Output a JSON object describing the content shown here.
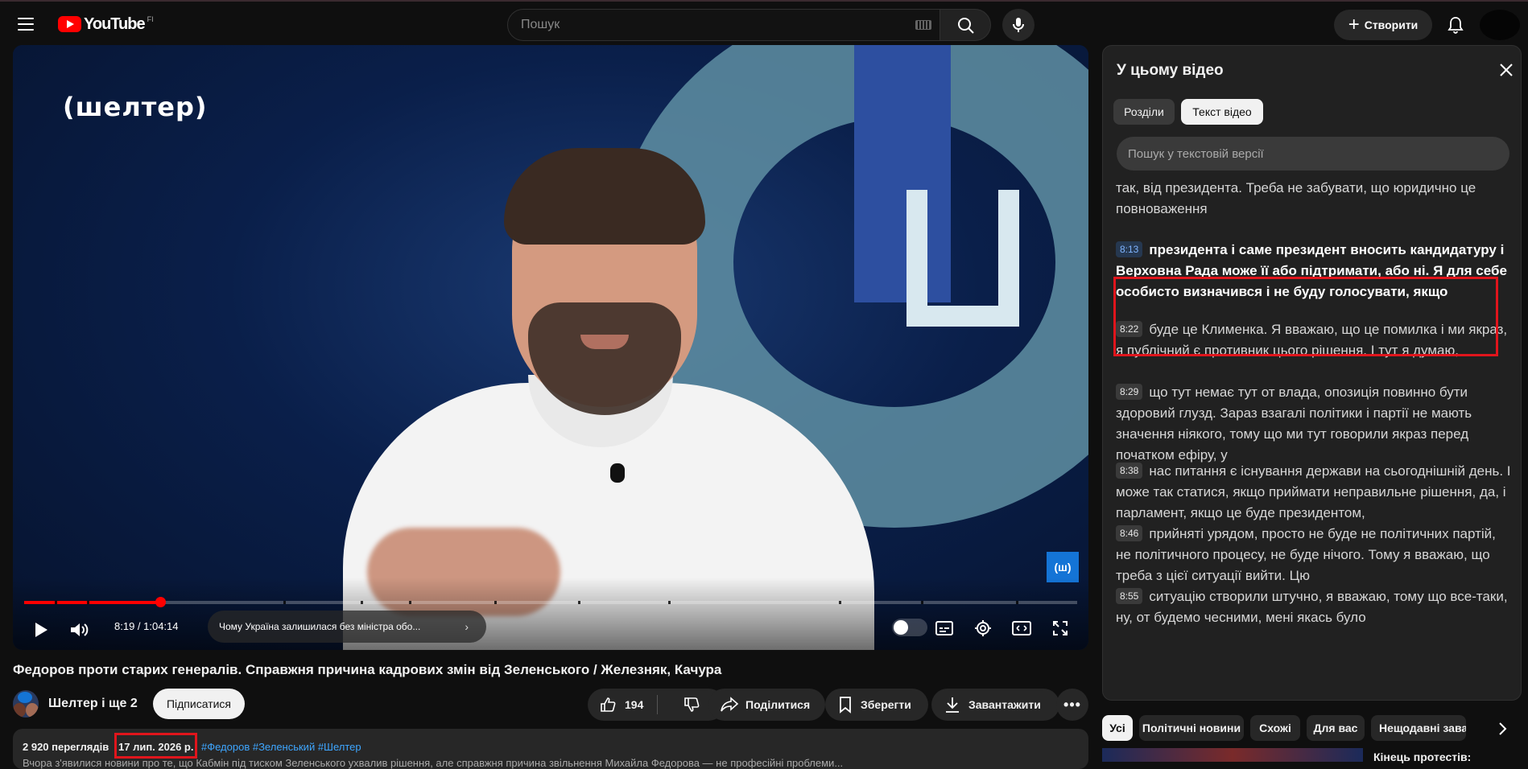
{
  "header": {
    "logo_text": "YouTube",
    "region": "FI",
    "search_placeholder": "Пошук",
    "create_label": "Створити"
  },
  "player": {
    "brand_overlay": "(шелтер)",
    "corner_badge": "(ш)",
    "time": "8:19 / 1:04:14",
    "chapter_title": "Чому Україна залишилася без міністра обо...",
    "progress_fraction": 0.129
  },
  "video": {
    "title": "Федоров проти старих генералів. Справжня причина кадрових змін від Зеленського / Железняк, Качура",
    "channel": "Шелтер і ще 2",
    "subscribe_label": "Підписатися",
    "likes": "194",
    "share_label": "Поділитися",
    "save_label": "Зберегти",
    "download_label": "Завантажити",
    "views": "2 920 переглядів",
    "date": "17 лип. 2026 р.",
    "hashtags": "#Федоров #Зеленський #Шелтер",
    "description_line": "Вчора з'явилися новини про те, що Кабмін під тиском Зеленського ухвалив рішення, але справжня причина звільнення Михайла Федорова — не професійні проблеми..."
  },
  "panel": {
    "title": "У цьому відео",
    "tabs": [
      {
        "label": "Розділи",
        "active": false
      },
      {
        "label": "Текст відео",
        "active": true
      }
    ],
    "search_placeholder": "Пошук у текстовій версії",
    "segments": [
      {
        "time": "",
        "text": "так, від президента. Треба не забувати, що юридично це повноваження"
      },
      {
        "time": "8:13",
        "text": "президента і саме президент вносить кандидатуру і Верховна Рада може її або підтримати, або ні. Я для себе особисто визначився і не буду голосувати, якщо"
      },
      {
        "time": "8:22",
        "text": "буде це Клименка. Я вважаю, що це помилка і ми якраз, я публічний є противник цього рішення. І тут я думаю,"
      },
      {
        "time": "8:29",
        "text": "що тут немає тут от влада, опозиція повинно бути здоровий глузд. Зараз взагалі політики і партії не мають значення ніякого, тому що ми тут говорили якраз перед початком ефіру, у"
      },
      {
        "time": "8:38",
        "text": "нас питання є існування держави на сьогоднішній день. І може так статися, якщо приймати неправильне рішення, да, і парламент, якщо це буде президентом,"
      },
      {
        "time": "8:46",
        "text": "прийняті урядом, просто не буде не політичних партій, не політичного процесу, не буде нічого. Тому я вважаю, що треба з цієї ситуації вийти. Цю"
      },
      {
        "time": "8:55",
        "text": "ситуацію створили штучно, я вважаю, тому що все-таки, ну, от будемо чесними, мені якась було"
      }
    ]
  },
  "recommendations": {
    "chips": [
      {
        "label": "Усі",
        "active": true
      },
      {
        "label": "Політичні новини",
        "active": false
      },
      {
        "label": "Схожі",
        "active": false
      },
      {
        "label": "Для вас",
        "active": false
      },
      {
        "label": "Нещодавні заван",
        "active": false
      }
    ],
    "first_title": "Кінець протестів:"
  },
  "colors": {
    "accent": "#ff0000",
    "highlight_box": "#e0151c",
    "link": "#3ea6ff"
  }
}
